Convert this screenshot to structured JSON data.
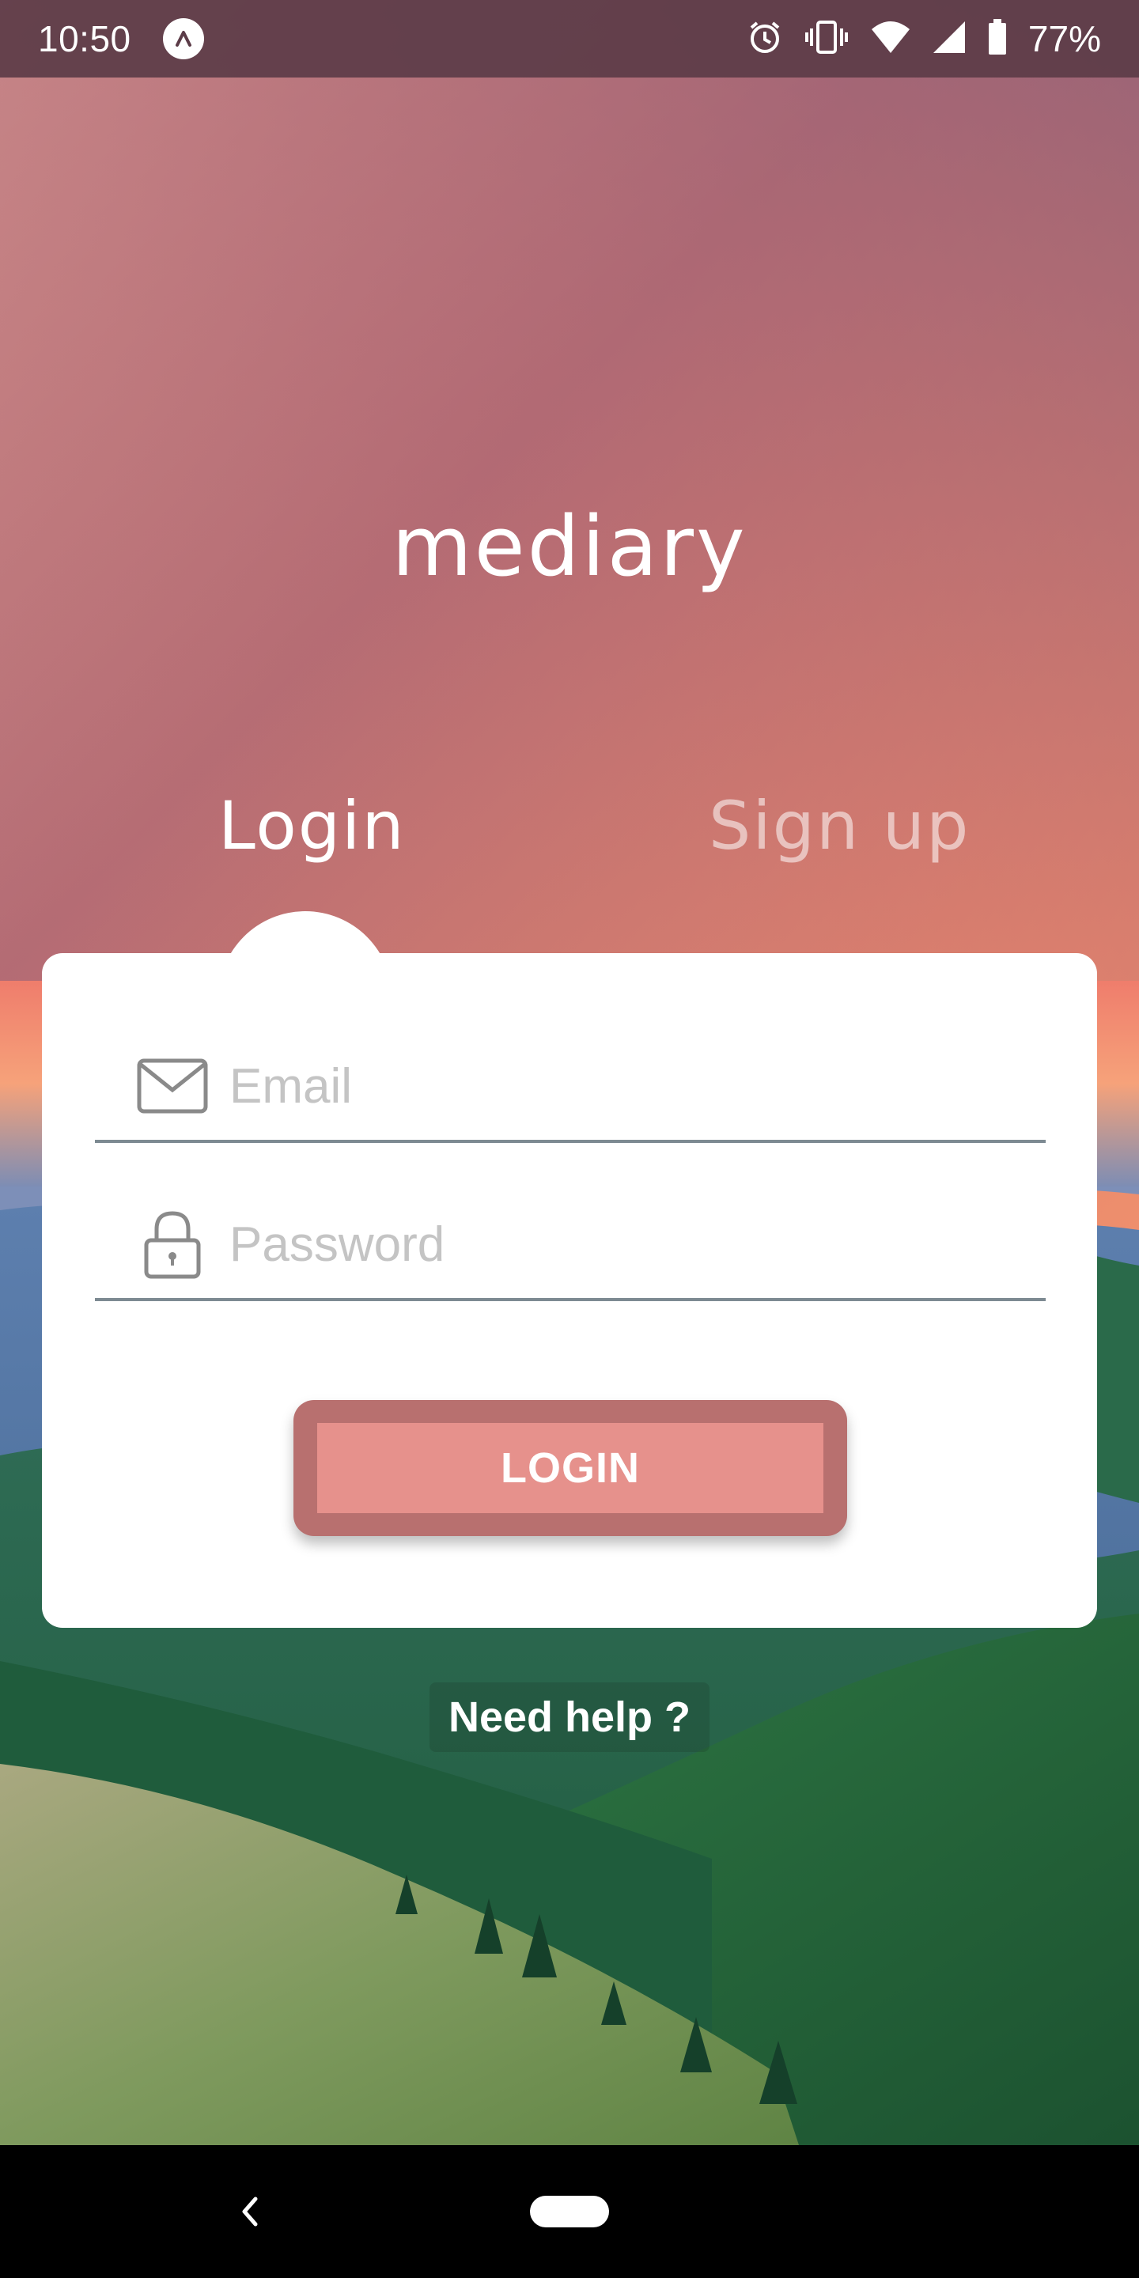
{
  "status_bar": {
    "time": "10:50",
    "battery": "77%",
    "icons": [
      "app-notification-icon",
      "alarm-icon",
      "vibrate-icon",
      "wifi-icon",
      "cell-signal-icon",
      "battery-icon"
    ]
  },
  "app": {
    "logo": "mediary"
  },
  "tabs": {
    "login": "Login",
    "signup": "Sign up"
  },
  "form": {
    "email_placeholder": "Email",
    "password_placeholder": "Password",
    "login_button": "LOGIN",
    "email_icon": "envelope-icon",
    "password_icon": "lock-icon"
  },
  "help": {
    "label": "Need help ?"
  },
  "colors": {
    "button_outer": "#b8706f",
    "button_inner": "#e6918c",
    "sky_top": "#a86a7a",
    "sky_bottom": "#f59a6f"
  }
}
